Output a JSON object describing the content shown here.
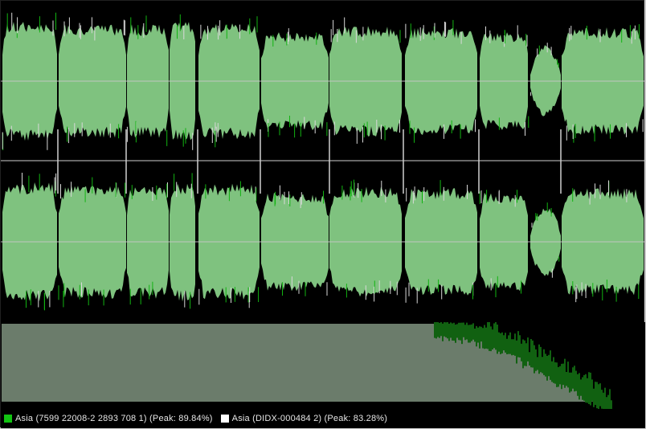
{
  "colors": {
    "background": "#000000",
    "waveform_fill": "#7fc27f",
    "waveform_peak_green": "#12b312",
    "waveform_peak_white": "#d8d8d8",
    "center_line": "#c8c8c8",
    "divider_line": "#d0d0d0",
    "spectrum_fill": "#d6f7d6",
    "spectrum_green": "#22c222"
  },
  "legend": {
    "items": [
      {
        "label": "Asia (7599 22008-2 2893 708 1) (Peak: 89.84%)",
        "color": "#12c412"
      },
      {
        "label": "Asia (DIDX-000484 2) (Peak: 83.28%)",
        "color": "#ffffff"
      }
    ]
  },
  "chart_data": [
    {
      "type": "area",
      "series": [
        {
          "name": "Asia (7599 22008-2 2893 708 1) (Peak: 89.84%)"
        },
        {
          "name": "Asia (DIDX-000484 2) (Peak: 83.28%)"
        }
      ]
    }
  ]
}
